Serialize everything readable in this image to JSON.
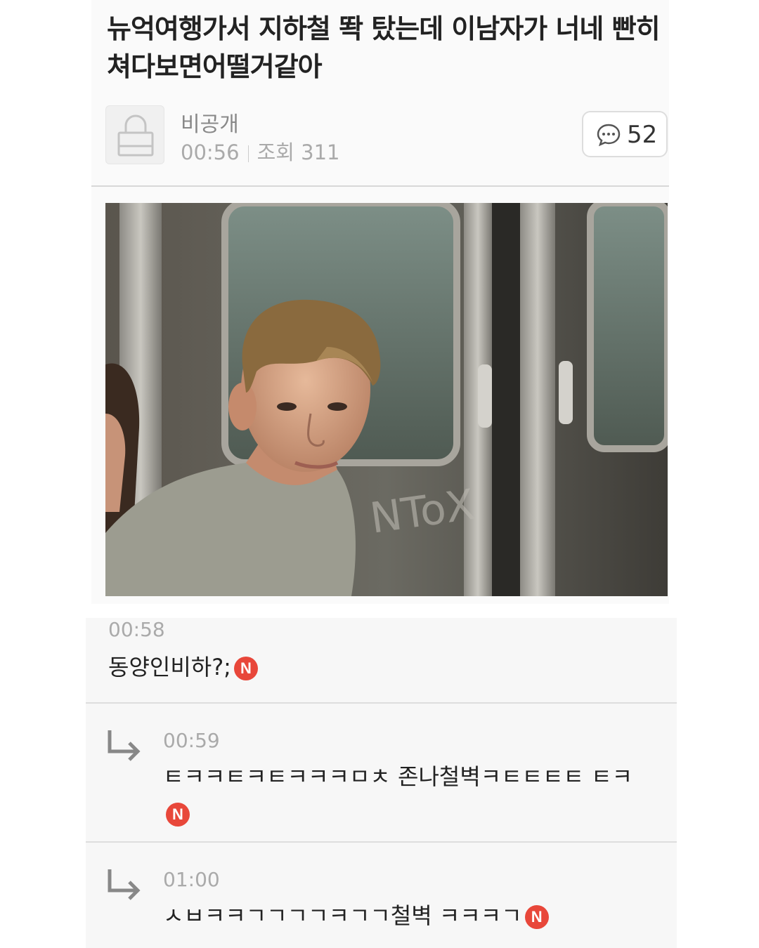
{
  "post": {
    "title": "뉴억여행가서 지하철 똭 탔는데 이남자가 너네 빤히쳐다보면어떨거같아",
    "author": "비공개",
    "time": "00:56",
    "views_label": "조회 311",
    "comment_count": "52"
  },
  "comments": [
    {
      "time": "00:58",
      "text": "동양인비하?;",
      "badge": "N",
      "is_reply": false
    },
    {
      "time": "00:59",
      "text": "ㅌㅋㅋㅌㅋㅌㅋㅋㅋㅁㅊ 존나철벽ㅋㅌㅌㅌㅌ ㅌㅋ",
      "badge": "N",
      "is_reply": true
    },
    {
      "time": "01:00",
      "text": "ㅅㅂㅋㅋㄱㄱㄱㄱㅋㄱㄱ철벽 ㅋㅋㅋㄱ",
      "badge": "N",
      "is_reply": true
    }
  ],
  "icons": {
    "avatar": "lock-icon",
    "comment": "speech-bubble-icon",
    "reply": "reply-arrow-icon"
  },
  "colors": {
    "new_badge": "#e8473a",
    "muted_text": "#aaaaaa"
  }
}
